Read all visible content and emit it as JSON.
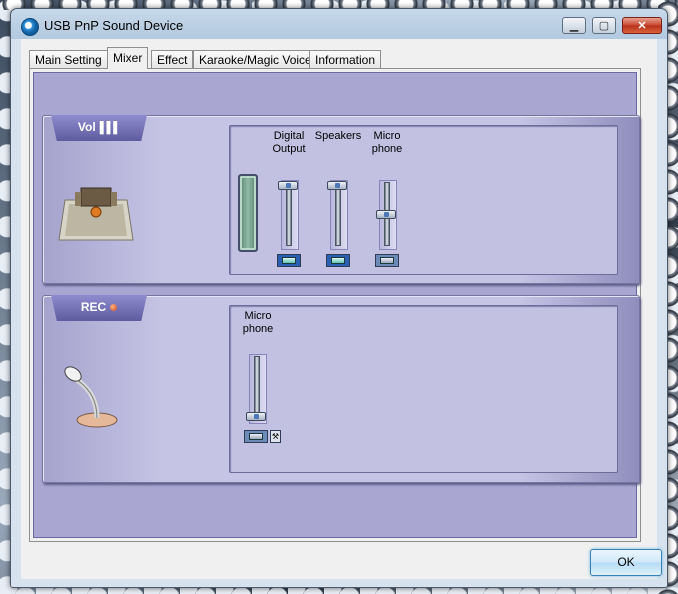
{
  "window": {
    "title": "USB PnP Sound Device",
    "minimize_glyph": "▁",
    "maximize_glyph": "▢",
    "close_glyph": "✕"
  },
  "tabs": [
    {
      "label": "Main Setting"
    },
    {
      "label": "Mixer",
      "active": true
    },
    {
      "label": "Effect"
    },
    {
      "label": "Karaoke/Magic Voice"
    },
    {
      "label": "Information"
    }
  ],
  "playback": {
    "tag_label": "Vol",
    "tag_icon": "volume-bars-icon",
    "channels": [
      {
        "label_line1": "Digital",
        "label_line2": "Output",
        "level": 1.0,
        "muted": false
      },
      {
        "label_line1": "Speakers",
        "label_line2": "",
        "level": 1.0,
        "muted": false
      },
      {
        "label_line1": "Micro",
        "label_line2": "phone",
        "level": 0.5,
        "muted": true
      }
    ]
  },
  "recording": {
    "tag_label": "REC",
    "tag_icon": "record-dot-icon",
    "channels": [
      {
        "label_line1": "Micro",
        "label_line2": "phone",
        "level": 0.0,
        "muted": true
      }
    ]
  },
  "footer": {
    "ok_label": "OK"
  },
  "colors": {
    "panel_bg": "#a9a7d1",
    "section_bg": "#c6c4e4",
    "tag_bg": "#6e6cb0"
  }
}
